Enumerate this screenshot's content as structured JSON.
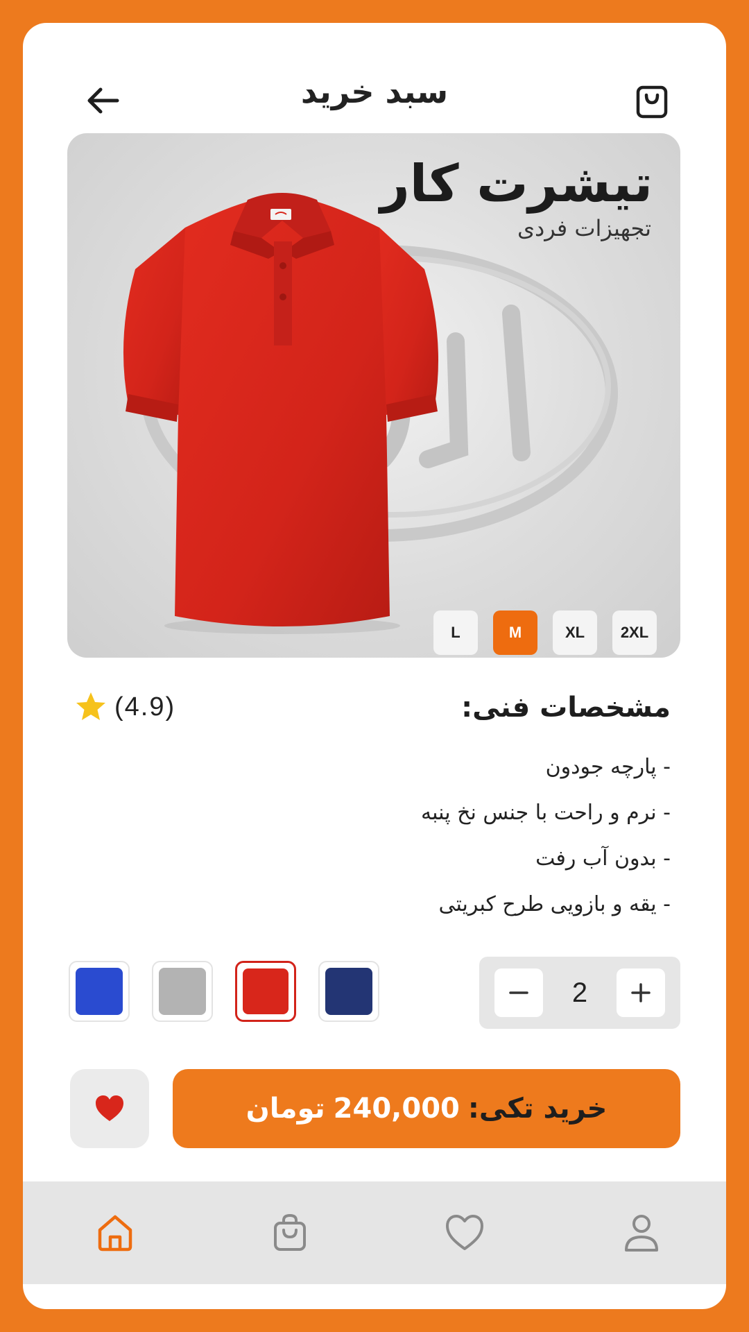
{
  "header": {
    "title": "سبد خرید",
    "back_icon": "arrow-left-icon",
    "bag_icon": "shopping-bag-icon"
  },
  "product": {
    "title": "تیشرت کار",
    "subtitle": "تجهیزات فردی",
    "sizes": [
      {
        "label": "2XL",
        "selected": false
      },
      {
        "label": "XL",
        "selected": false
      },
      {
        "label": "M",
        "selected": true
      },
      {
        "label": "L",
        "selected": false
      }
    ],
    "shirt_color": "#D8261B"
  },
  "rating": {
    "value": "(4.9)",
    "icon": "star-icon"
  },
  "specs": {
    "title": "مشخصات فنی:",
    "items": [
      "- پارچه جودون",
      "- نرم و راحت با جنس نخ پنبه",
      "- بدون آب رفت",
      "- یقه و بازویی طرح کبریتی"
    ]
  },
  "colors": [
    {
      "name": "blue",
      "hex": "#2A4BD0",
      "selected": false
    },
    {
      "name": "gray",
      "hex": "#B3B3B3",
      "selected": false
    },
    {
      "name": "red",
      "hex": "#D8261B",
      "selected": true
    },
    {
      "name": "navy",
      "hex": "#233574",
      "selected": false
    }
  ],
  "quantity": {
    "value": "2",
    "minus_icon": "minus-icon",
    "plus_icon": "plus-icon"
  },
  "buy": {
    "label": "خرید تکی:",
    "price": "240,000",
    "currency": "تومان",
    "favorite_icon": "heart-icon"
  },
  "nav": {
    "items": [
      {
        "icon": "home-icon",
        "active": true
      },
      {
        "icon": "shopping-bag-icon",
        "active": false
      },
      {
        "icon": "heart-outline-icon",
        "active": false
      },
      {
        "icon": "user-icon",
        "active": false
      }
    ]
  },
  "colors_theme": {
    "accent": "#EE7A1D",
    "background": "#ED7A1E",
    "active_size": "#EE6C0F"
  }
}
